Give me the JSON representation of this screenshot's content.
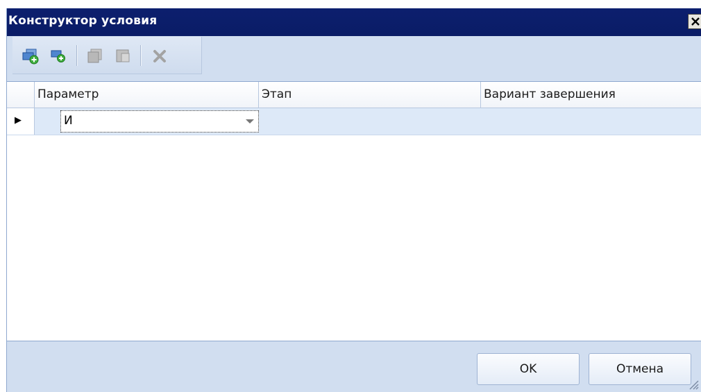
{
  "window": {
    "title": "Конструктор условия"
  },
  "toolbar": {
    "buttons": [
      {
        "icon": "add-condition-group-icon",
        "enabled": true
      },
      {
        "icon": "add-condition-icon",
        "enabled": true
      },
      {
        "icon": "copy-icon",
        "enabled": false
      },
      {
        "icon": "paste-icon",
        "enabled": false
      },
      {
        "icon": "delete-icon",
        "enabled": false
      }
    ]
  },
  "grid": {
    "columns": [
      "Параметр",
      "Этап",
      "Вариант завершения"
    ],
    "rows": [
      {
        "current": true,
        "parameter": "И",
        "stage": "",
        "completion": ""
      }
    ]
  },
  "footer": {
    "ok_label": "OK",
    "cancel_label": "Отмена"
  },
  "colors": {
    "titlebar": "#0a1c66",
    "window_bg": "#d1def0",
    "selected_row": "#dde9f8"
  }
}
